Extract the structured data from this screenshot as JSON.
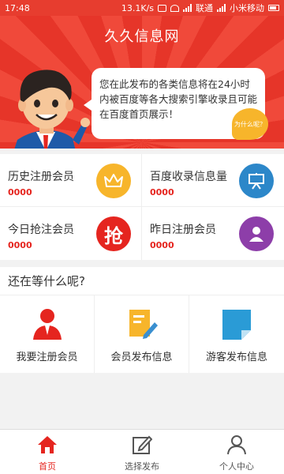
{
  "status_bar": {
    "time": "17:48",
    "speed": "13.1K/s",
    "carrier1": "联通",
    "carrier2": "小米移动"
  },
  "banner": {
    "title": "久久信息网",
    "bubble_text": "您在此发布的各类信息将在24小时内被百度等各大搜索引擎收录且可能在百度首页展示！",
    "why_badge": "为什么呢？"
  },
  "stats": [
    {
      "label": "历史注册会员",
      "value": "0000",
      "icon": "crown-icon",
      "color": "#f7b52b"
    },
    {
      "label": "百度收录信息量",
      "value": "0000",
      "icon": "presentation-board-icon",
      "color": "#2c87c9"
    },
    {
      "label": "今日抢注会员",
      "value": "0000",
      "icon": "grab-icon",
      "icon_char": "抢",
      "color": "#e5251f"
    },
    {
      "label": "昨日注册会员",
      "value": "0000",
      "icon": "user-icon",
      "color": "#8d3ea9"
    }
  ],
  "wait_section": {
    "title": "还在等什么呢?",
    "items": [
      {
        "label": "我要注册会员",
        "icon": "member-register-icon"
      },
      {
        "label": "会员发布信息",
        "icon": "member-post-icon"
      },
      {
        "label": "游客发布信息",
        "icon": "guest-post-icon"
      }
    ]
  },
  "tabbar": {
    "tabs": [
      {
        "label": "首页",
        "icon": "home-icon",
        "active": true
      },
      {
        "label": "选择发布",
        "icon": "edit-icon",
        "active": false
      },
      {
        "label": "个人中心",
        "icon": "person-icon",
        "active": false
      }
    ]
  },
  "colors": {
    "brand_red": "#e5251f",
    "banner_red": "#e73d2f"
  }
}
